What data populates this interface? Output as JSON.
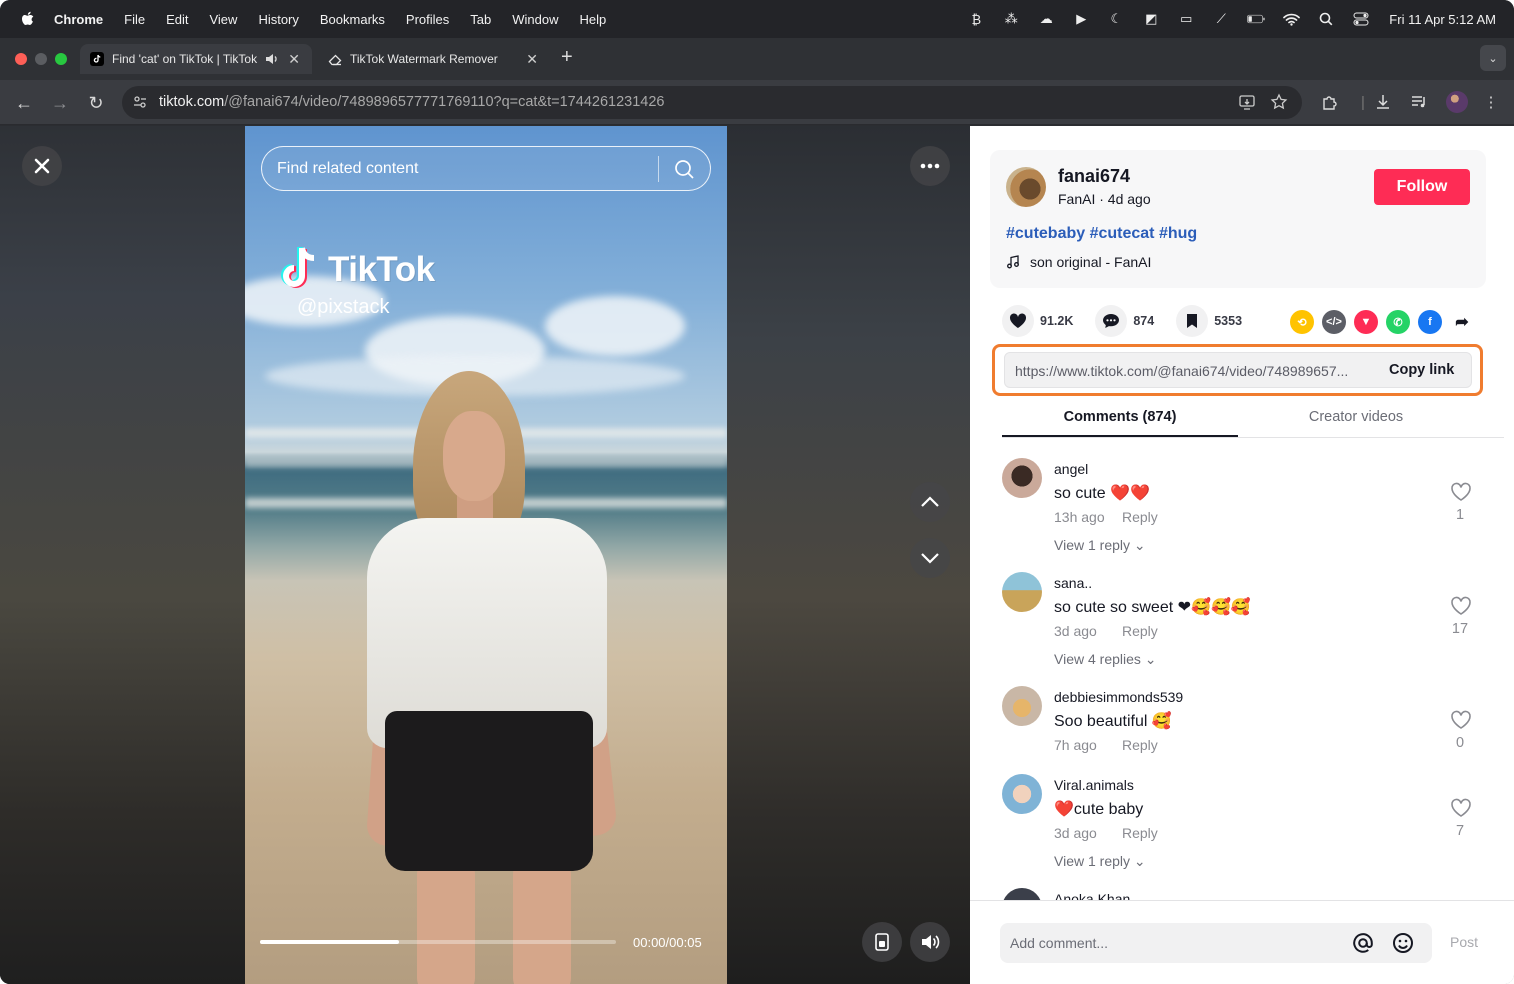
{
  "menubar": {
    "app": "Chrome",
    "items": [
      "File",
      "Edit",
      "View",
      "History",
      "Bookmarks",
      "Profiles",
      "Tab",
      "Window",
      "Help"
    ],
    "clock": "Fri 11 Apr  5:12 AM"
  },
  "tabs": [
    {
      "title": "Find 'cat' on TikTok | TikTok",
      "active": true,
      "favicon": "tiktok-icon",
      "audio": true
    },
    {
      "title": "TikTok Watermark Remover fo",
      "active": false,
      "favicon": "eraser-icon"
    }
  ],
  "toolbar": {
    "url_host": "tiktok.com",
    "url_path": "/@fanai674/video/7489896577771769110?q=cat&t=1744261231426"
  },
  "video": {
    "search_placeholder": "Find related content",
    "watermark_brand": "TikTok",
    "watermark_user": "@pixstack",
    "progress": 0.39,
    "timecode": "00:00/00:05"
  },
  "post": {
    "username": "fanai674",
    "meta": "FanAI · 4d ago",
    "follow_label": "Follow",
    "hashtags": "#cutebaby #cutecat #hug",
    "music": "son original - FanAI",
    "likes": "91.2K",
    "comments": "874",
    "saves": "5353",
    "link": "https://www.tiktok.com/@fanai674/video/748989657...",
    "copy_label": "Copy link"
  },
  "panel_tabs": {
    "comments": "Comments (874)",
    "creator": "Creator videos"
  },
  "comments": [
    {
      "user": "angel",
      "text": "so cute ❤️❤️",
      "time": "13h ago",
      "reply": "Reply",
      "view": "View 1 reply",
      "likes": "1"
    },
    {
      "user": "sana..",
      "text": "so cute so sweet ❤🥰🥰🥰",
      "time": "3d ago",
      "reply": "Reply",
      "view": "View 4 replies",
      "likes": "17"
    },
    {
      "user": "debbiesimmonds539",
      "text": "Soo beautiful 🥰",
      "time": "7h ago",
      "reply": "Reply",
      "view": "",
      "likes": "0"
    },
    {
      "user": "Viral.animals",
      "text": "❤️cute baby",
      "time": "3d ago",
      "reply": "Reply",
      "view": "View 1 reply",
      "likes": "7"
    },
    {
      "user": "Anoka Khan",
      "text": "",
      "time": "",
      "reply": "",
      "view": "",
      "likes": ""
    }
  ],
  "composer": {
    "placeholder": "Add comment...",
    "post_label": "Post"
  },
  "colors": {
    "accent": "#fe2c55",
    "hashtag": "#2b5db9",
    "highlight": "#f07c2f"
  }
}
